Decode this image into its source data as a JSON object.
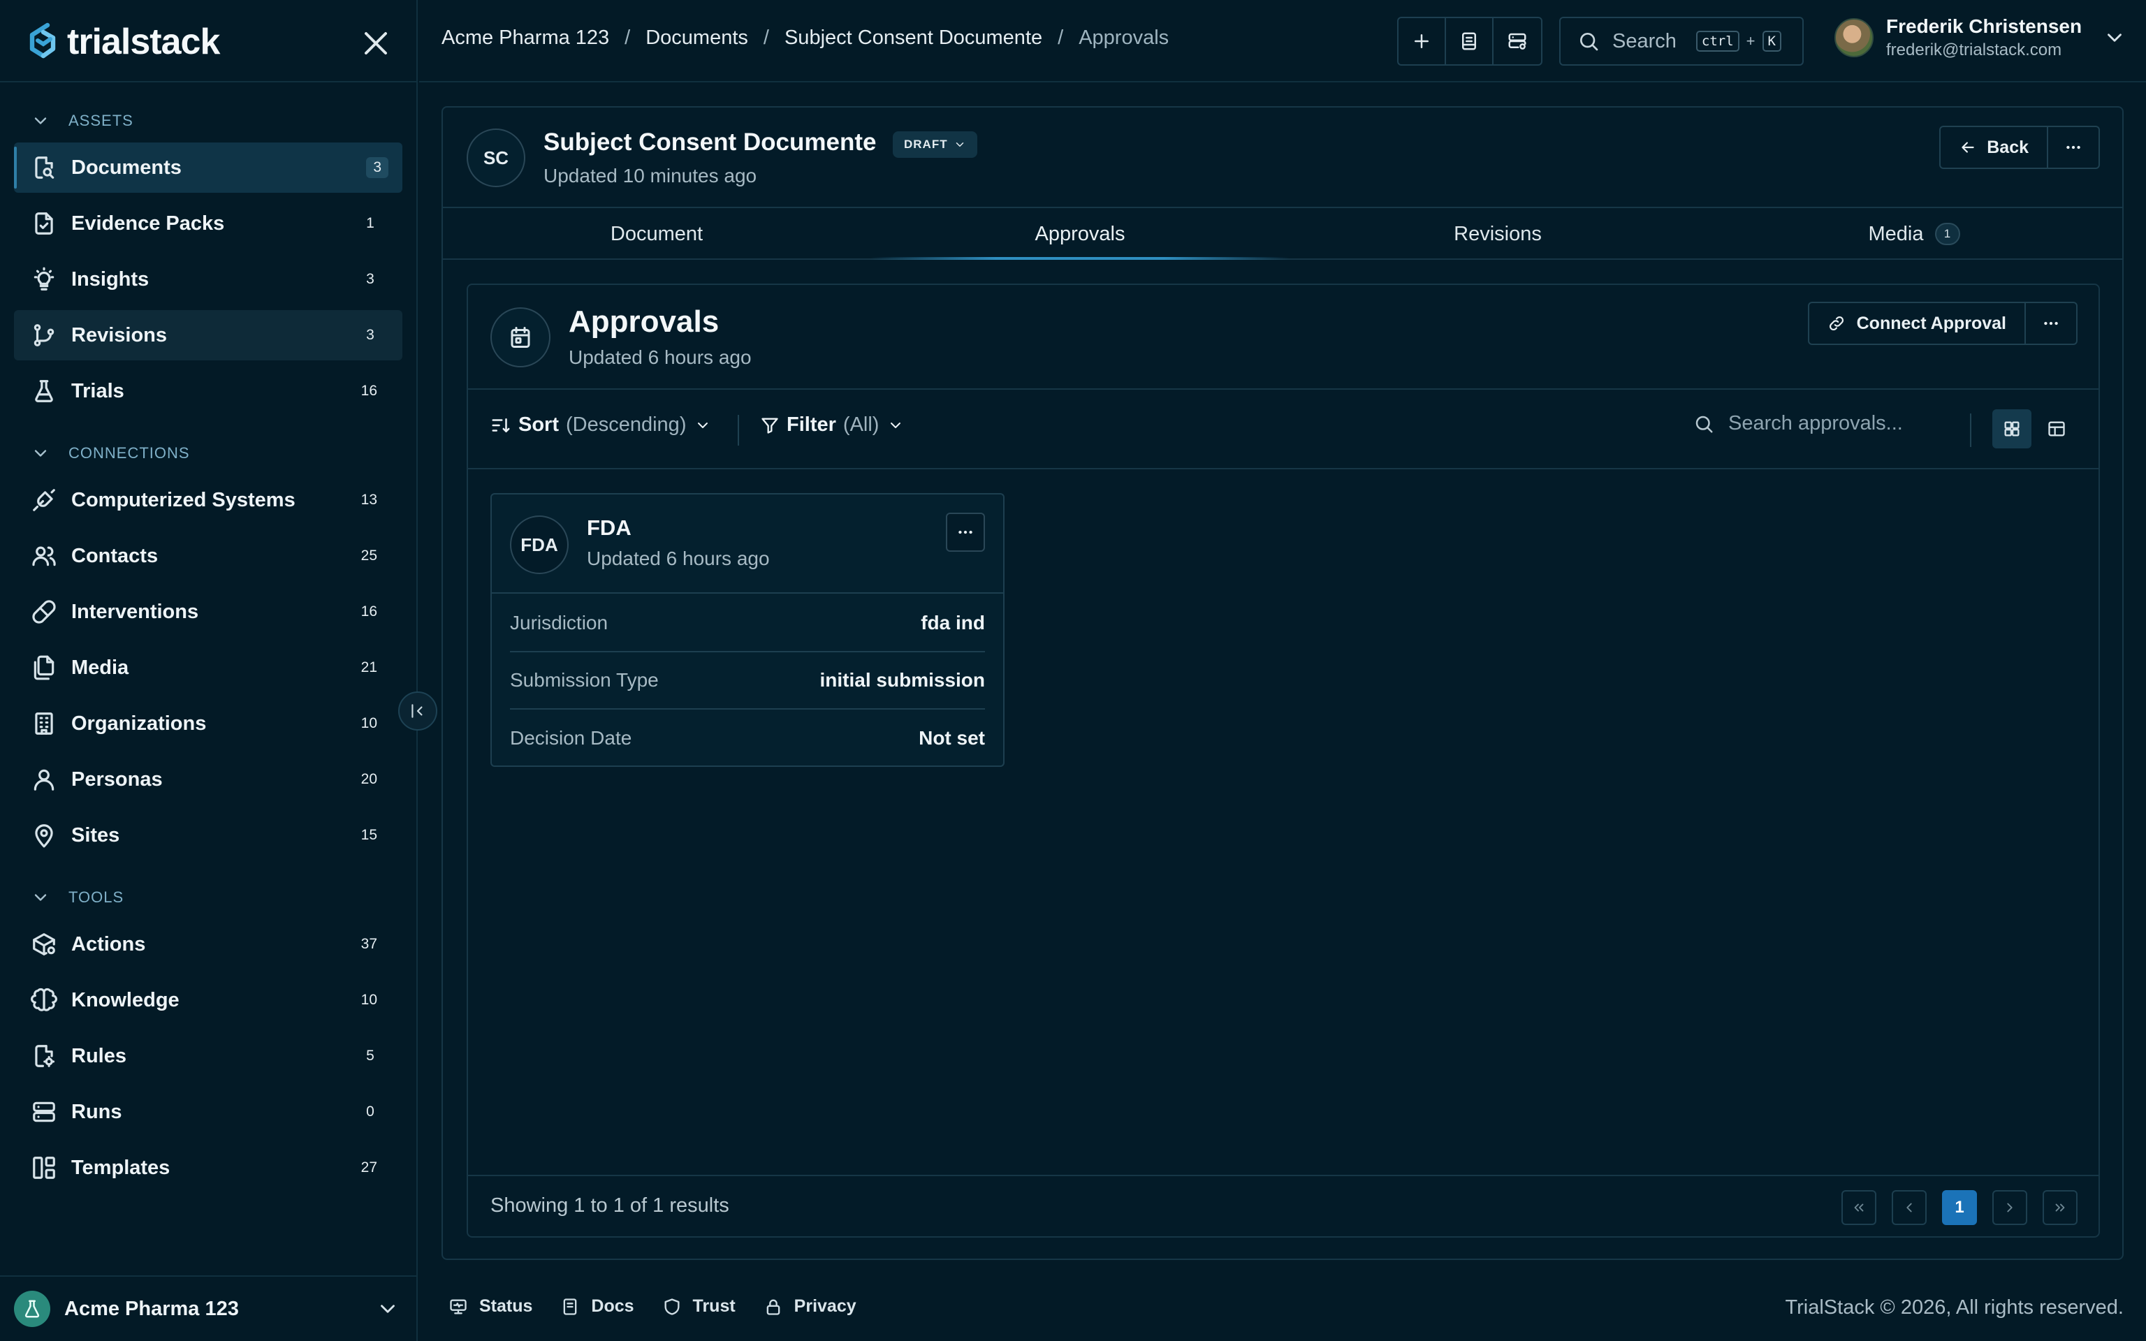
{
  "app": {
    "name": "trialstack"
  },
  "sidebar": {
    "sections": [
      {
        "title": "ASSETS"
      },
      {
        "title": "CONNECTIONS"
      },
      {
        "title": "TOOLS"
      }
    ],
    "items": [
      {
        "label": "Documents",
        "count": "3"
      },
      {
        "label": "Evidence Packs",
        "count": "1"
      },
      {
        "label": "Insights",
        "count": "3"
      },
      {
        "label": "Revisions",
        "count": "3"
      },
      {
        "label": "Trials",
        "count": "16"
      },
      {
        "label": "Computerized Systems",
        "count": "13"
      },
      {
        "label": "Contacts",
        "count": "25"
      },
      {
        "label": "Interventions",
        "count": "16"
      },
      {
        "label": "Media",
        "count": "21"
      },
      {
        "label": "Organizations",
        "count": "10"
      },
      {
        "label": "Personas",
        "count": "20"
      },
      {
        "label": "Sites",
        "count": "15"
      },
      {
        "label": "Actions",
        "count": "37"
      },
      {
        "label": "Knowledge",
        "count": "10"
      },
      {
        "label": "Rules",
        "count": "5"
      },
      {
        "label": "Runs",
        "count": "0"
      },
      {
        "label": "Templates",
        "count": "27"
      }
    ],
    "org": {
      "name": "Acme Pharma 123"
    }
  },
  "topbar": {
    "breadcrumbs": [
      "Acme Pharma 123",
      "Documents",
      "Subject Consent Documente",
      "Approvals"
    ],
    "separator": "/",
    "search": {
      "label": "Search",
      "key1": "ctrl",
      "plus": "+",
      "key2": "K"
    },
    "user": {
      "name": "Frederik Christensen",
      "email": "frederik@trialstack.com"
    }
  },
  "document": {
    "initials": "SC",
    "title": "Subject Consent Documente",
    "status": "DRAFT",
    "updated": "Updated 10 minutes ago",
    "back_label": "Back",
    "tabs": [
      {
        "label": "Document"
      },
      {
        "label": "Approvals"
      },
      {
        "label": "Revisions"
      },
      {
        "label": "Media",
        "count": "1"
      }
    ]
  },
  "approvals": {
    "title": "Approvals",
    "updated": "Updated 6 hours ago",
    "connect_label": "Connect Approval",
    "sort_label": "Sort",
    "sort_value": "(Descending)",
    "filter_label": "Filter",
    "filter_value": "(All)",
    "search_placeholder": "Search approvals...",
    "cards": [
      {
        "initials": "FDA",
        "title": "FDA",
        "updated": "Updated 6 hours ago",
        "fields": [
          {
            "key": "Jurisdiction",
            "value": "fda ind"
          },
          {
            "key": "Submission Type",
            "value": "initial submission"
          },
          {
            "key": "Decision Date",
            "value": "Not set"
          }
        ]
      }
    ],
    "results_text": "Showing 1 to 1 of 1 results",
    "pager": {
      "first": "«",
      "prev": "‹",
      "current": "1",
      "next": "›",
      "last": "»"
    }
  },
  "footer": {
    "links": [
      {
        "label": "Status"
      },
      {
        "label": "Docs"
      },
      {
        "label": "Trust"
      },
      {
        "label": "Privacy"
      }
    ],
    "copyright": "TrialStack © 2026, All rights reserved."
  },
  "colors": {
    "background": "#031a26",
    "accent": "#1b73b8",
    "border": "#163646"
  }
}
